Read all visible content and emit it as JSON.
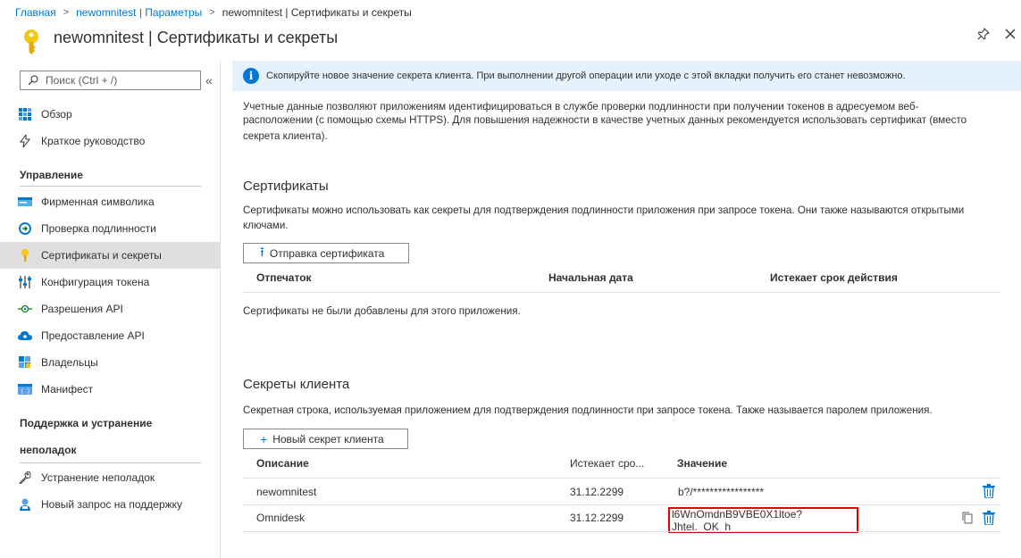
{
  "breadcrumb": {
    "home": "Главная",
    "parent": "newomnitest | Параметры",
    "current": "newomnitest | Сертификаты и секреты"
  },
  "header": {
    "title": "newomnitest | Сертификаты и секреты"
  },
  "sidebar": {
    "search_placeholder": "Поиск (Ctrl + /)",
    "collapse": "«",
    "items": [
      {
        "label": "Обзор",
        "icon": "grid-icon"
      },
      {
        "label": "Краткое руководство",
        "icon": "quickstart-icon"
      },
      {
        "label": "Фирменная символика",
        "icon": "branding-icon"
      },
      {
        "label": "Проверка подлинности",
        "icon": "auth-icon"
      },
      {
        "label": "Сертификаты и секреты",
        "icon": "key-icon"
      },
      {
        "label": "Конфигурация токена",
        "icon": "token-icon"
      },
      {
        "label": "Разрешения API",
        "icon": "api-permissions-icon"
      },
      {
        "label": "Предоставление API",
        "icon": "expose-api-icon"
      },
      {
        "label": "Владельцы",
        "icon": "owners-icon"
      },
      {
        "label": "Манифест",
        "icon": "manifest-icon"
      },
      {
        "label": "Устранение неполадок",
        "icon": "wrench-icon"
      },
      {
        "label": "Новый запрос на поддержку",
        "icon": "support-icon"
      }
    ],
    "section_manage": "Управление",
    "section_support_line1": "Поддержка и устранение",
    "section_support_line2": "неполадок"
  },
  "main": {
    "info": "Скопируйте новое значение секрета клиента. При выполнении другой операции или уходе с этой вкладки получить его станет невозможно.",
    "intro_line1": "Учетные данные позволяют приложениям идентифицироваться в службе проверки подлинности при получении токенов в адресуемом веб-",
    "intro_line2": "расположении (с помощью схемы HTTPS). Для повышения надежности в качестве учетных данных рекомендуется использовать сертификат (вместо",
    "intro_line3": "секрета клиента).",
    "certs": {
      "title": "Сертификаты",
      "desc_line1": "Сертификаты можно использовать как секреты для подтверждения подлинности приложения при запросе токена. Они также называются открытыми",
      "desc_line2": "ключами.",
      "upload_button": "Отправка сертификата",
      "col_thumbprint": "Отпечаток",
      "col_start": "Начальная дата",
      "col_expires": "Истекает срок действия",
      "empty": "Сертификаты не были добавлены для этого приложения."
    },
    "secrets": {
      "title": "Секреты клиента",
      "desc": "Секретная строка, используемая приложением для подтверждения подлинности при запросе токена. Также называется паролем приложения.",
      "new_button": "Новый секрет клиента",
      "col_desc": "Описание",
      "col_expires": "Истекает сро...",
      "col_value": "Значение",
      "rows": [
        {
          "description": "newomnitest",
          "expires": "31.12.2299",
          "value": "b?/*****************"
        },
        {
          "description": "Omnidesk",
          "expires": "31.12.2299",
          "value": "l6WnOmdnB9VBE0X1ltoe?Jhtel._OK_h"
        }
      ]
    }
  }
}
